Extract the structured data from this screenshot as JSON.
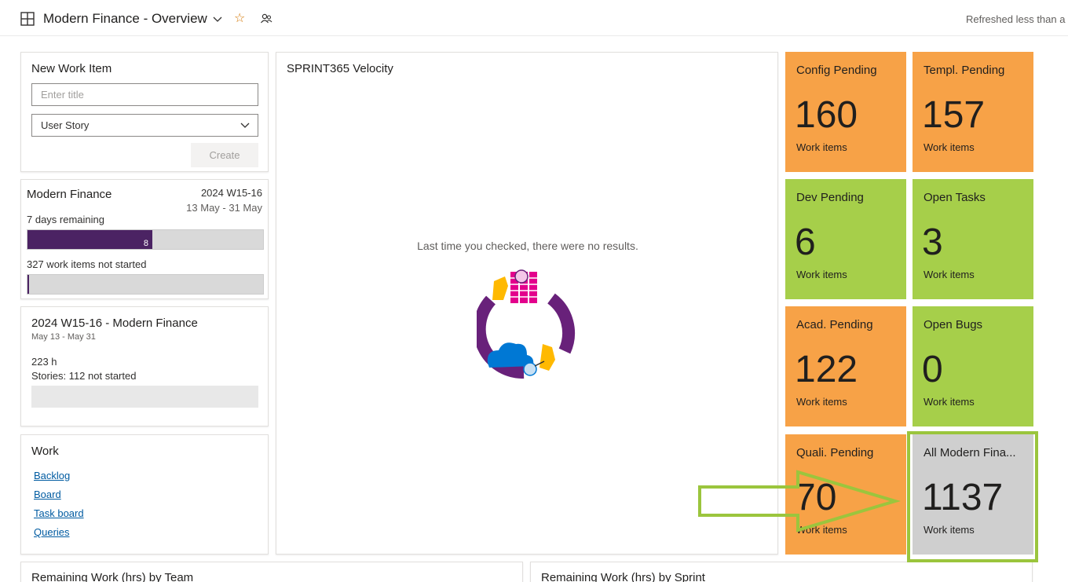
{
  "header": {
    "title": "Modern Finance - Overview",
    "refreshed": "Refreshed less than a m"
  },
  "new_work_item": {
    "title": "New Work Item",
    "placeholder": "Enter title",
    "type_value": "User Story",
    "create_label": "Create"
  },
  "sprint": {
    "team": "Modern Finance",
    "iteration": "2024 W15-16",
    "dates": "13 May - 31 May",
    "days_remaining": "7 days remaining",
    "progress_value": "8",
    "progress_fraction": 0.53,
    "not_started": "327 work items not started",
    "not_started_fraction": 0.0
  },
  "capacity": {
    "title": "2024 W15-16 - Modern Finance",
    "dates": "May 13 - May 31",
    "hours": "223 h",
    "stories": "Stories: 112 not started"
  },
  "work": {
    "title": "Work",
    "links": [
      "Backlog",
      "Board",
      "Task board",
      "Queries"
    ]
  },
  "velocity": {
    "title": "SPRINT365 Velocity",
    "empty_message": "Last time you checked, there were no results."
  },
  "tiles": [
    {
      "title": "Config Pending",
      "count": "160",
      "sub": "Work items",
      "color": "#f7a247"
    },
    {
      "title": "Templ. Pending",
      "count": "157",
      "sub": "Work items",
      "color": "#f7a247"
    },
    {
      "title": "Dev Pending",
      "count": "6",
      "sub": "Work items",
      "color": "#a6cf4a"
    },
    {
      "title": "Open Tasks",
      "count": "3",
      "sub": "Work items",
      "color": "#a6cf4a"
    },
    {
      "title": "Acad. Pending",
      "count": "122",
      "sub": "Work items",
      "color": "#f7a247"
    },
    {
      "title": "Open Bugs",
      "count": "0",
      "sub": "Work items",
      "color": "#a6cf4a"
    },
    {
      "title": "Quali. Pending",
      "count": "70",
      "sub": "Work items",
      "color": "#f7a247"
    },
    {
      "title": "All Modern Fina...",
      "count": "1137",
      "sub": "Work items",
      "color": "#cfcfcf"
    }
  ],
  "bottom": {
    "left_title": "Remaining Work (hrs) by Team",
    "right_title": "Remaining Work (hrs) by Sprint"
  },
  "colors": {
    "highlight": "#9bc53d",
    "accent_purple": "#4b2363"
  }
}
